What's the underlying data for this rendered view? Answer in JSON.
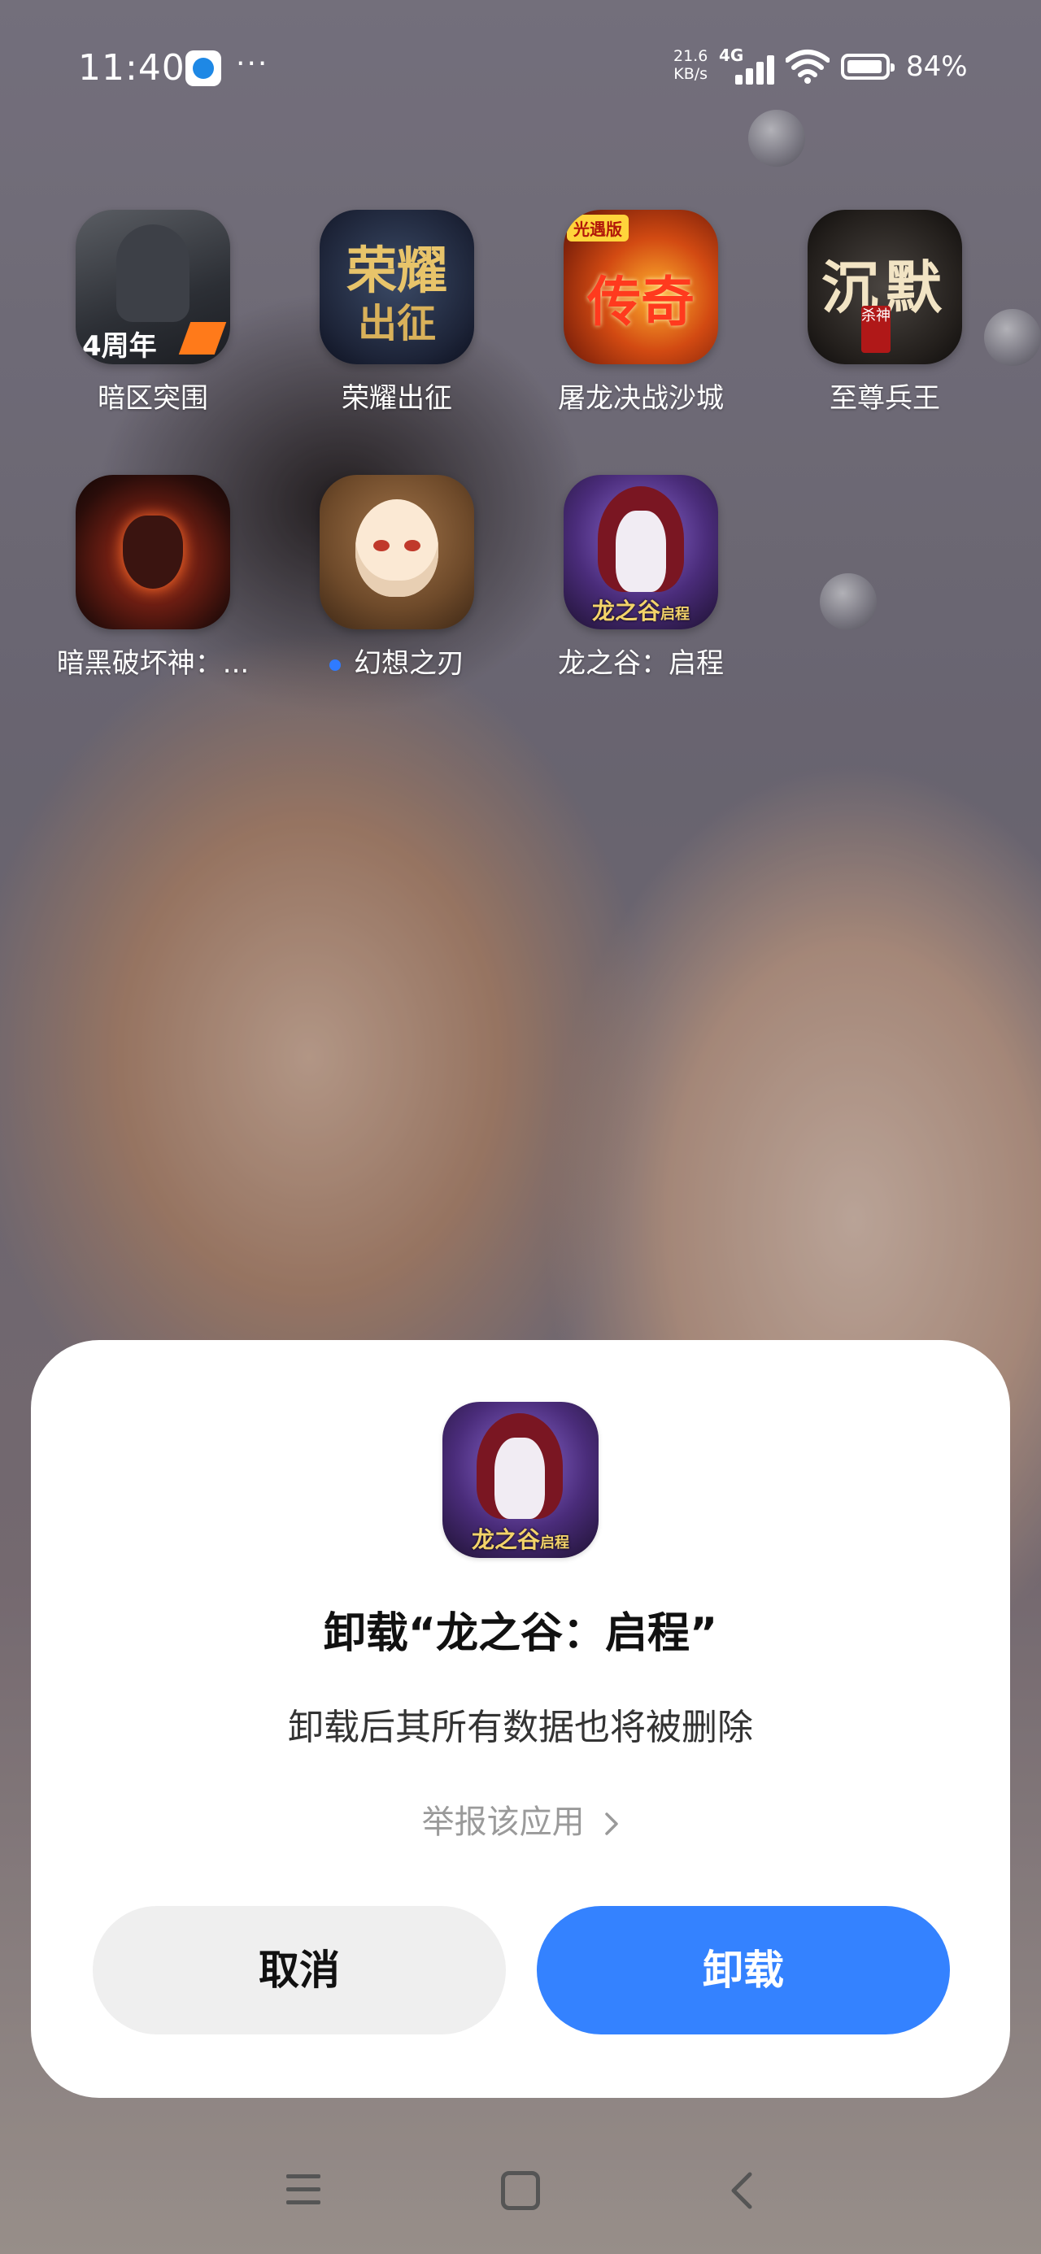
{
  "status_bar": {
    "time": "11:40",
    "more": "···",
    "net_speed_value": "21.6",
    "net_speed_unit": "KB/s",
    "network": "4G",
    "battery": "84%"
  },
  "apps": [
    {
      "label": "暗区突围",
      "icon": "anqu-tuwei-icon",
      "badge_text": "4周年"
    },
    {
      "label": "荣耀出征",
      "icon": "rongyao-chuzheng-icon",
      "title_text": "荣耀",
      "sub_text": "出征"
    },
    {
      "label": "屠龙决战沙城",
      "icon": "tulong-juezhan-icon",
      "tag_text": "光遇版",
      "title_text": "传奇"
    },
    {
      "label": "至尊兵王",
      "icon": "zhizun-bingwang-icon",
      "title_text": "沉默",
      "seal_text": "杀神"
    },
    {
      "label": "暗黑破坏神：...",
      "icon": "diablo-icon"
    },
    {
      "label": "幻想之刃",
      "icon": "huanxiang-zhiren-icon",
      "new_dot": true
    },
    {
      "label": "龙之谷：启程",
      "icon": "longzhigu-qicheng-icon",
      "logo_text": "龙之谷",
      "logo_sub": "启程"
    }
  ],
  "dialog": {
    "icon": "longzhigu-qicheng-icon",
    "logo_text": "龙之谷",
    "logo_sub": "启程",
    "title": "卸载“龙之谷：启程”",
    "message": "卸载后其所有数据也将被删除",
    "report_link": "举报该应用",
    "cancel_label": "取消",
    "uninstall_label": "卸载"
  },
  "nav_bar": {
    "items": [
      "menu-icon",
      "home-icon",
      "back-icon"
    ]
  },
  "colors": {
    "accent": "#3482ff",
    "cancel_bg": "#efefef",
    "dialog_bg": "#ffffff",
    "new_dot": "#2f7bff"
  }
}
